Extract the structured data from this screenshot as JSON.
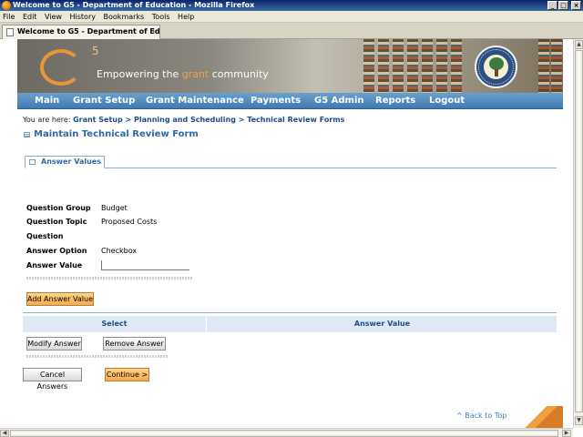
{
  "window": {
    "title": "Welcome to G5 - Department of Education - Mozilla Firefox",
    "menu": [
      "File",
      "Edit",
      "View",
      "History",
      "Bookmarks",
      "Tools",
      "Help"
    ],
    "tab_title": "Welcome to G5 - Department of Edu...",
    "tab_close": "+",
    "min": "_",
    "max": "□",
    "close": "×"
  },
  "brand": {
    "logo_letter": "G",
    "logo_super": "5",
    "tagline_pre": "Empowering the ",
    "tagline_em": "grant",
    "tagline_post": " community"
  },
  "nav": [
    "Main",
    "Grant Setup",
    "Grant Maintenance",
    "Payments",
    "G5 Admin",
    "Reports",
    "Logout"
  ],
  "breadcrumb": {
    "prefix": "You are here: ",
    "items": [
      "Grant Setup",
      "Planning and Scheduling",
      "Technical Review Forms"
    ],
    "sep": " > "
  },
  "page_title": "Maintain Technical Review Form",
  "section_tab": "Answer Values",
  "fields": {
    "question_group_label": "Question Group",
    "question_group_value": "Budget",
    "question_topic_label": "Question Topic",
    "question_topic_value": "Proposed Costs",
    "question_label": "Question",
    "answer_option_label": "Answer Option",
    "answer_option_value": "Checkbox",
    "answer_value_label": "Answer Value",
    "answer_value_input": ""
  },
  "buttons": {
    "add_answer_value": "Add Answer Value",
    "modify_answer": "Modify Answer",
    "remove_answer": "Remove Answer",
    "cancel_answers": "Cancel Answers",
    "continue": "Continue >"
  },
  "table": {
    "col_select": "Select",
    "col_answer_value": "Answer Value"
  },
  "back_to_top": "^ Back to Top",
  "colors": {
    "nav_bg": "#4f88bf",
    "link_blue": "#1d4d86",
    "accent_orange": "#f6ab48"
  }
}
